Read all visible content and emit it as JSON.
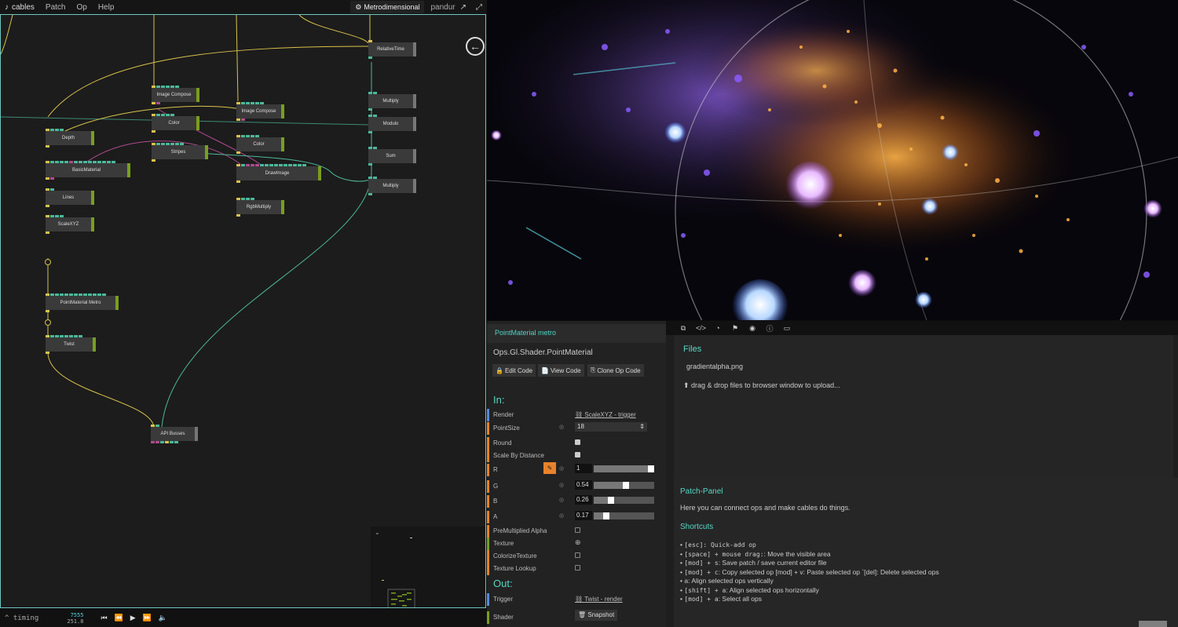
{
  "menu": {
    "brand": "cables",
    "items": [
      "Patch",
      "Op",
      "Help"
    ],
    "project": "Metrodimensional",
    "user": "pandur"
  },
  "ops": [
    {
      "label": "RelativeTime"
    },
    {
      "label": "Image Compose"
    },
    {
      "label": "Image Compose"
    },
    {
      "label": "Multiply"
    },
    {
      "label": "Color"
    },
    {
      "label": "Modulo"
    },
    {
      "label": "Depth"
    },
    {
      "label": "Color"
    },
    {
      "label": "Stripes"
    },
    {
      "label": "Sum"
    },
    {
      "label": "BasicMaterial"
    },
    {
      "label": "DrawImage"
    },
    {
      "label": "Multiply"
    },
    {
      "label": "Lines"
    },
    {
      "label": "RgbMultiply"
    },
    {
      "label": "ScaleXYZ"
    },
    {
      "label": "PointMaterial Metro"
    },
    {
      "label": "Twist"
    },
    {
      "label": "API Busses"
    }
  ],
  "timing": {
    "label": "timing",
    "frame": "7555",
    "seconds": "251.8"
  },
  "params": {
    "tab": "PointMaterial metro",
    "optype": "Ops.Gl.Shader.PointMaterial",
    "buttons": [
      "Edit Code",
      "View Code",
      "Clone Op Code"
    ],
    "in_label": "In:",
    "out_label": "Out:",
    "render": {
      "name": "Render",
      "link": "ScaleXYZ - trigger"
    },
    "pointsize": {
      "name": "PointSize",
      "value": "18"
    },
    "round": {
      "name": "Round",
      "checked": true
    },
    "scale_by_distance": {
      "name": "Scale By Distance",
      "checked": true
    },
    "r": {
      "name": "R",
      "value": "1",
      "fraction": 1.0
    },
    "g": {
      "name": "G",
      "value": "0.54",
      "fraction": 0.54
    },
    "b": {
      "name": "B",
      "value": "0.26",
      "fraction": 0.26
    },
    "a": {
      "name": "A",
      "value": "0.17",
      "fraction": 0.17
    },
    "premultiplied": {
      "name": "PreMultiplied Alpha",
      "checked": false
    },
    "texture": {
      "name": "Texture"
    },
    "colorize": {
      "name": "ColorizeTexture",
      "checked": false
    },
    "texture_lookup": {
      "name": "Texture Lookup",
      "checked": false
    },
    "trigger": {
      "name": "Trigger",
      "link": "Twist - render"
    },
    "shader": {
      "name": "Shader",
      "button": "Snapshot"
    }
  },
  "files": {
    "heading": "Files",
    "file": "gradientalpha.png",
    "drop": "drag & drop files to browser window to upload..."
  },
  "help": {
    "heading": "Patch-Panel",
    "desc": "Here you can connect ops and make cables do things.",
    "shortcuts_heading": "Shortcuts",
    "shortcuts": [
      {
        "key": "[esc]: Quick-add op",
        "rest": ""
      },
      {
        "key": "[space] + mouse drag:",
        "rest": ": Move the visible area"
      },
      {
        "key": "[mod] + s",
        "rest": ": Save patch / save current editor file"
      },
      {
        "key": "[mod] + c",
        "rest": ": Copy selected op [mod] + v: Paste selected op `[del]: Delete selected ops"
      },
      {
        "key": "",
        "rest": "a: Align selected ops vertically"
      },
      {
        "key": "[shift] + a",
        "rest": ": Align selected ops horizontally"
      },
      {
        "key": "[mod] + a",
        "rest": ": Select all ops"
      }
    ]
  },
  "colors": {
    "accent": "#56d6c6",
    "op_green": "#7a9e1f",
    "port_teal": "#4cb89a",
    "port_yellow": "#d9c24b",
    "port_pink": "#b04a8f",
    "picker_orange": "#e8822c"
  }
}
